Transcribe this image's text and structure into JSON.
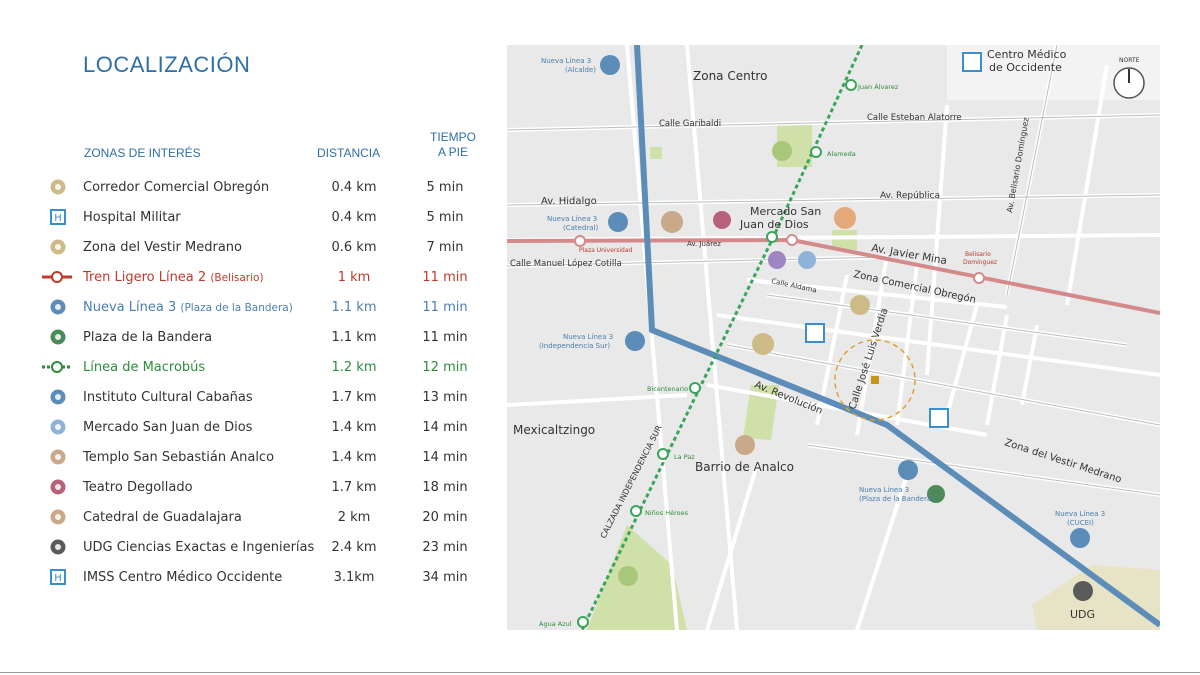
{
  "title": "LOCALIZACIÓN",
  "headers": {
    "zones": "ZONAS DE INTERÉS",
    "distance": "DISTANCIA",
    "time_line1": "TIEMPO",
    "time_line2": "A PIE"
  },
  "rows": [
    {
      "icon": "shopping-bag-icon",
      "name": "Corredor Comercial Obregón",
      "sub": "",
      "distance": "0.4 km",
      "time": "5 min",
      "color": "#333333"
    },
    {
      "icon": "hospital-icon",
      "name": "Hospital Militar",
      "sub": "",
      "distance": "0.4 km",
      "time": "5 min",
      "color": "#333333"
    },
    {
      "icon": "clothing-icon",
      "name": "Zona del Vestir Medrano",
      "sub": "",
      "distance": "0.6 km",
      "time": "7 min",
      "color": "#333333"
    },
    {
      "icon": "light-rail-line-icon",
      "name": "Tren Ligero Línea 2",
      "sub": "(Belisario)",
      "distance": "1 km",
      "time": "11 min",
      "color": "#c0392b"
    },
    {
      "icon": "train-icon",
      "name": "Nueva Línea  3",
      "sub": "(Plaza de la Bandera)",
      "distance": "1.1 km",
      "time": "11 min",
      "color": "#4a7fb0"
    },
    {
      "icon": "flag-icon",
      "name": "Plaza de la Bandera",
      "sub": "",
      "distance": "1.1 km",
      "time": "11 min",
      "color": "#333333"
    },
    {
      "icon": "macrobus-line-icon",
      "name": "Línea de Macrobús",
      "sub": "",
      "distance": "1.2 km",
      "time": "12 min",
      "color": "#2e8b3d"
    },
    {
      "icon": "museum-icon",
      "name": "Instituto Cultural Cabañas",
      "sub": "",
      "distance": "1.7 km",
      "time": "13 min",
      "color": "#333333"
    },
    {
      "icon": "market-icon",
      "name": "Mercado San Juan de Dios",
      "sub": "",
      "distance": "1.4 km",
      "time": "14 min",
      "color": "#333333"
    },
    {
      "icon": "church-icon",
      "name": "Templo San Sebastián Analco",
      "sub": "",
      "distance": "1.4 km",
      "time": "14 min",
      "color": "#333333"
    },
    {
      "icon": "theater-icon",
      "name": "Teatro Degollado",
      "sub": "",
      "distance": "1.7 km",
      "time": "18 min",
      "color": "#333333"
    },
    {
      "icon": "cathedral-icon",
      "name": "Catedral de Guadalajara",
      "sub": "",
      "distance": "2 km",
      "time": "20 min",
      "color": "#333333"
    },
    {
      "icon": "graduation-cap-icon",
      "name": "UDG Ciencias Exactas e Ingenierías",
      "sub": "",
      "distance": "2.4 km",
      "time": "23 min",
      "color": "#333333"
    },
    {
      "icon": "hospital-icon",
      "name": "IMSS Centro Médico Occidente",
      "sub": "",
      "distance": "3.1km",
      "time": "34 min",
      "color": "#333333"
    }
  ],
  "map": {
    "zones": [
      "Zona Centro",
      "Mexicaltzingo",
      "Barrio de Analco"
    ],
    "streets": [
      "Calle Garibaldi",
      "Calle Esteban Alatorre",
      "Av. Hidalgo",
      "Av. República",
      "Av. Juárez",
      "Calle Manuel López Cotilla",
      "Av. Javier Mina",
      "Calle Aldama",
      "Zona Comercial Obregón",
      "Calle José Luis Verdia",
      "Av. Revolución",
      "Zona del Vestir Medrano",
      "Av. Belisario Domínguez",
      "CALZADA INDEPENDENCIA SUR"
    ],
    "stations": [
      "Juan Álvarez",
      "Alameda",
      "Bicentenario",
      "La Paz",
      "Niños Héroes",
      "Agua Azul",
      "Plaza Universidad",
      "Belisario Domínguez"
    ],
    "metro_labels": [
      "Nueva Línea 3",
      "(Alcalde)",
      "(Catedral)",
      "(Independencia Sur)",
      "(Plaza de la Bandera)",
      "(CUCEI)"
    ],
    "poi_labels": [
      "Mercado San",
      "Juan de Dios",
      "Centro Médico",
      "de Occidente",
      "UDG"
    ],
    "compass": "NORTE",
    "colors": {
      "metro": "#5b8db8",
      "light_rail": "#d48a8a",
      "macrobus": "#3aa55a",
      "park": "#cfe0a8",
      "street": "#ffffff",
      "block": "#e9e9e9"
    }
  }
}
